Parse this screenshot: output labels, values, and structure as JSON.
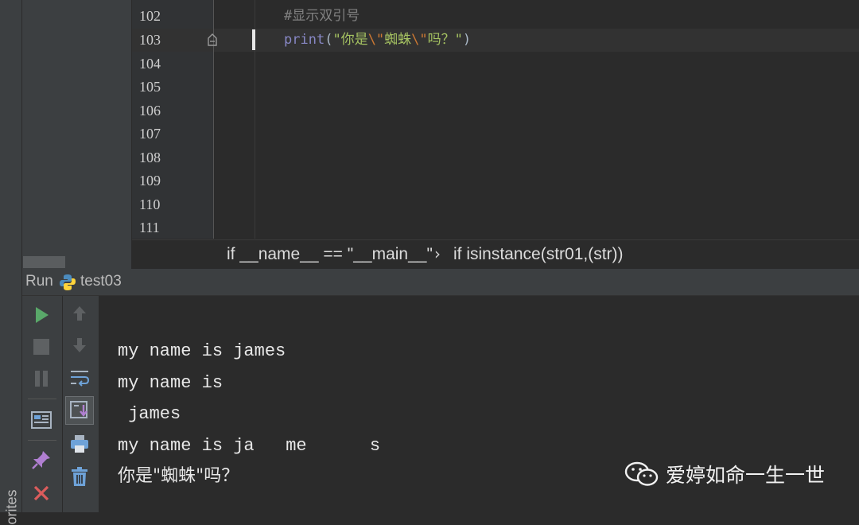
{
  "sidebar": {
    "favorites_label": "orites"
  },
  "editor": {
    "line_numbers": [
      "102",
      "103",
      "104",
      "105",
      "106",
      "107",
      "108",
      "109",
      "110",
      "111"
    ],
    "current_line": "103",
    "code": {
      "line102": "#显示双引号",
      "line103": {
        "func": "print",
        "open": "(",
        "str_start": "\"你是",
        "esc1": "\\\"",
        "mid": "蜘蛛",
        "esc2": "\\\"",
        "str_end": "吗？\"",
        "close": ")"
      }
    }
  },
  "breadcrumb": {
    "first": "if __name__ == \"__main__\"",
    "separator": "›",
    "second": "if isinstance(str01,(str))"
  },
  "run_window": {
    "title": "Run",
    "config_name": "test03",
    "toolbar_icons": [
      "rerun-icon",
      "stop-icon",
      "pause-icon",
      "layout-icon",
      "pin-icon",
      "close-icon",
      "up-arrow-icon",
      "down-arrow-icon",
      "soft-wrap-icon",
      "scroll-to-end-icon",
      "print-icon",
      "trash-icon"
    ]
  },
  "console": {
    "lines": [
      "my name is james",
      "my name is",
      " james",
      "my name is ja\tme\ts",
      "你是\"蜘蛛\"吗？"
    ]
  },
  "watermark": {
    "text": "爱婷如命一生一世"
  },
  "colors": {
    "editor_bg": "#2b2b2b",
    "panel_bg": "#3c3f41",
    "comment": "#808080",
    "keyword": "#8888c6",
    "string": "#a5c261",
    "escape": "#cc7832",
    "run_green": "#59a869",
    "close_red": "#db5c5c"
  }
}
